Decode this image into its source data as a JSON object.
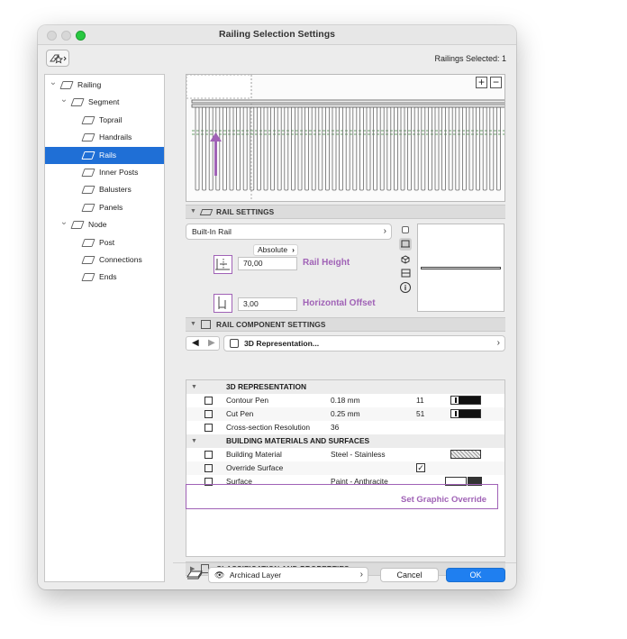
{
  "window": {
    "title": "Railing Selection Settings",
    "selection_count": "Railings Selected: 1"
  },
  "tree": {
    "items": [
      {
        "label": "Railing",
        "level": 0,
        "chevron": "chevron-down-icon",
        "icon": "railing-icon",
        "selected": false
      },
      {
        "label": "Segment",
        "level": 1,
        "chevron": "chevron-down-icon",
        "icon": "segment-icon",
        "selected": false
      },
      {
        "label": "Toprail",
        "level": 2,
        "chevron": "",
        "icon": "toprail-icon",
        "selected": false
      },
      {
        "label": "Handrails",
        "level": 2,
        "chevron": "",
        "icon": "handrails-icon",
        "selected": false
      },
      {
        "label": "Rails",
        "level": 2,
        "chevron": "",
        "icon": "rails-icon",
        "selected": true
      },
      {
        "label": "Inner Posts",
        "level": 2,
        "chevron": "",
        "icon": "inner-posts-icon",
        "selected": false
      },
      {
        "label": "Balusters",
        "level": 2,
        "chevron": "",
        "icon": "balusters-icon",
        "selected": false
      },
      {
        "label": "Panels",
        "level": 2,
        "chevron": "",
        "icon": "panels-icon",
        "selected": false
      },
      {
        "label": "Node",
        "level": 1,
        "chevron": "chevron-down-icon",
        "icon": "node-icon",
        "selected": false
      },
      {
        "label": "Post",
        "level": 2,
        "chevron": "",
        "icon": "post-icon",
        "selected": false
      },
      {
        "label": "Connections",
        "level": 2,
        "chevron": "",
        "icon": "connections-icon",
        "selected": false
      },
      {
        "label": "Ends",
        "level": 2,
        "chevron": "",
        "icon": "ends-icon",
        "selected": false
      }
    ]
  },
  "preview": {
    "zoom_in": "+",
    "zoom_out": "−"
  },
  "rail_settings": {
    "header": "RAIL SETTINGS",
    "type_popup": "Built-In Rail",
    "reference": "Absolute",
    "rail_height_value": "70,00",
    "rail_height_label": "Rail Height",
    "offset_value": "3,00",
    "offset_label": "Horizontal Offset"
  },
  "component_settings": {
    "header": "RAIL COMPONENT SETTINGS",
    "representation": "3D Representation...",
    "groups": [
      {
        "title": "3D REPRESENTATION",
        "rows": [
          {
            "name": "Contour Pen",
            "value": "0.18 mm",
            "extra": "11",
            "swatch": "pen",
            "icon": "contour-pen-icon"
          },
          {
            "name": "Cut Pen",
            "value": "0.25 mm",
            "extra": "51",
            "swatch": "pen",
            "icon": "cut-pen-icon"
          },
          {
            "name": "Cross-section Resolution",
            "value": "36",
            "extra": "",
            "swatch": "",
            "icon": "resolution-icon"
          }
        ]
      },
      {
        "title": "BUILDING MATERIALS AND SURFACES",
        "rows": [
          {
            "name": "Building Material",
            "value": "Steel - Stainless",
            "extra": "",
            "swatch": "material",
            "icon": "building-material-icon"
          },
          {
            "name": "Override Surface",
            "value": "",
            "extra": "✓",
            "swatch": "",
            "icon": "override-surface-icon"
          },
          {
            "name": "Surface",
            "value": "Paint - Anthracite",
            "extra": "",
            "swatch": "surface",
            "icon": "surface-icon"
          }
        ]
      }
    ],
    "annotation": "Set Graphic Override"
  },
  "classification": {
    "header": "CLASSIFICATION AND PROPERTIES"
  },
  "footer": {
    "layer": "Archicad Layer",
    "cancel": "Cancel",
    "ok": "OK"
  },
  "colors": {
    "accent": "#1f6fd6",
    "annotation": "#a062b6",
    "traffic_red": "#fc5f57",
    "traffic_yellow": "#fdbc2e",
    "traffic_green": "#28c840"
  }
}
